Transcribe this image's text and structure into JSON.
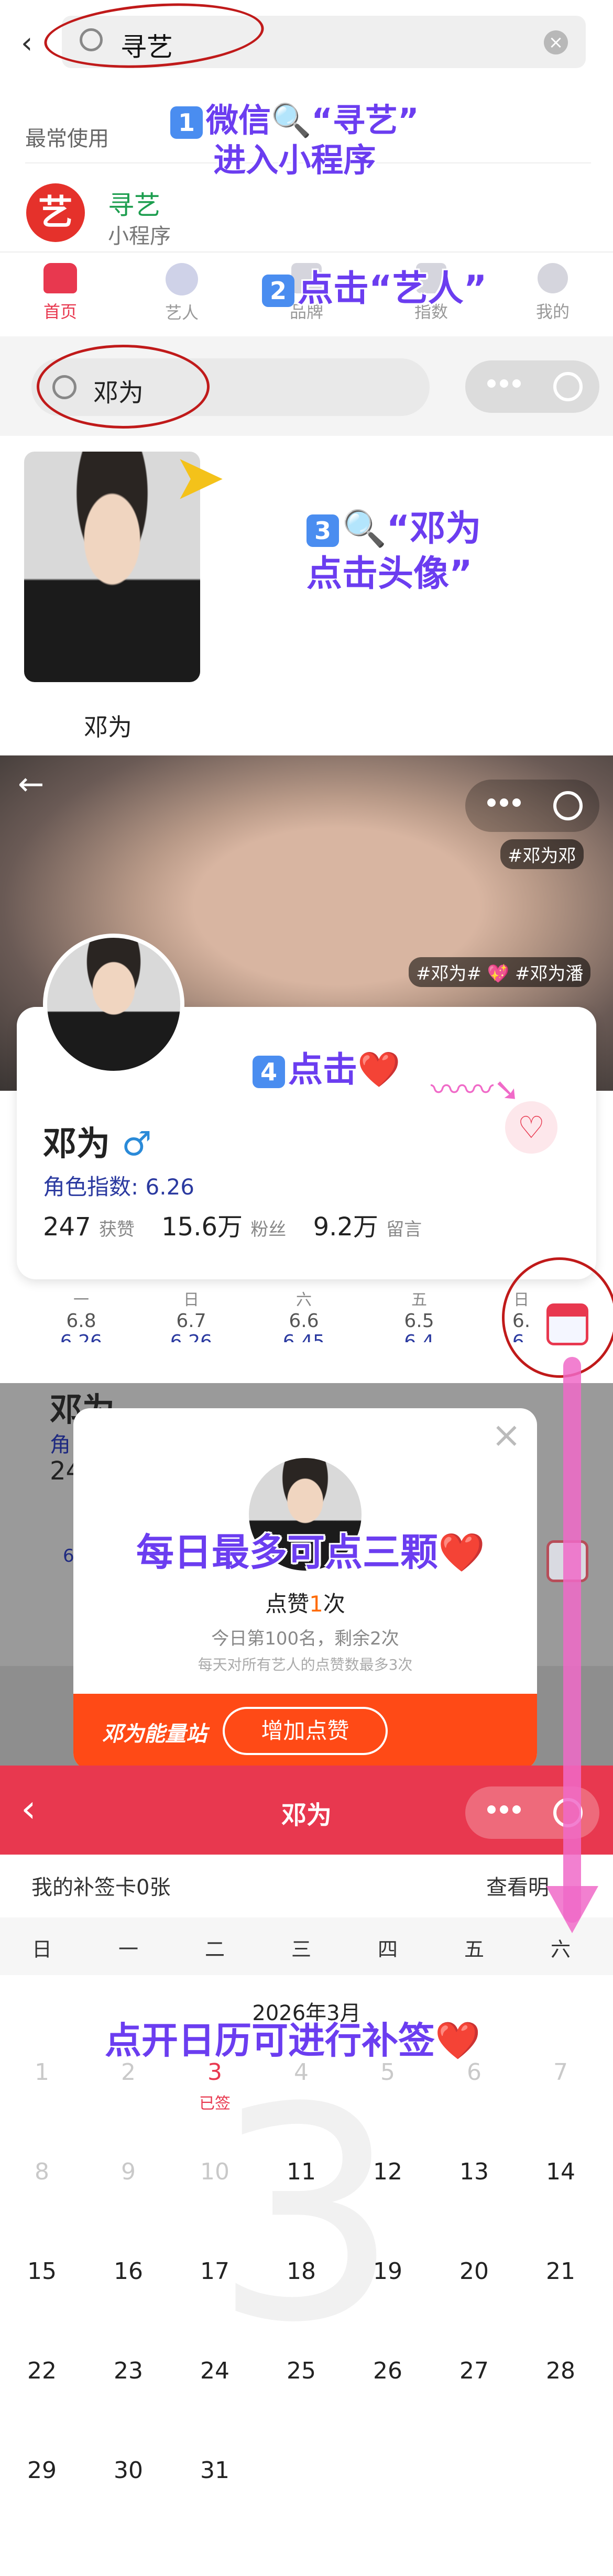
{
  "search": {
    "value": "寻艺",
    "recent_label": "最常使用",
    "app_name": "寻艺",
    "app_type": "小程序",
    "app_icon_char": "艺"
  },
  "steps": {
    "step1_a": "微信🔍“寻艺”",
    "step1_b": "进入小程序",
    "step1_num": "1",
    "step2": "点击“艺人”",
    "step2_num": "2",
    "step3_a": "🔍“邓为",
    "step3_b": "点击头像”",
    "step3_num": "3",
    "step4": "点击❤️",
    "step4_num": "4",
    "step5": "每日最多可点三颗❤️",
    "step6": "点开日历可进行补签❤️"
  },
  "tabs": [
    {
      "label": "首页",
      "active": true
    },
    {
      "label": "艺人"
    },
    {
      "label": "品牌"
    },
    {
      "label": "指数"
    },
    {
      "label": "我的"
    }
  ],
  "artist_search": {
    "value": "邓为",
    "result_name": "邓为"
  },
  "profile": {
    "tag1": "#邓为邓",
    "tag2": "#邓为#",
    "tag3": "#邓为潘",
    "name": "邓为",
    "gender": "♂",
    "index_label": "角色指数:",
    "index_value": "6.26",
    "stats": [
      {
        "value": "247",
        "label": "获赞"
      },
      {
        "value": "15.6万",
        "label": "粉丝"
      },
      {
        "value": "9.2万",
        "label": "留言"
      }
    ],
    "days": [
      {
        "wd": "一",
        "date": "6.8",
        "val": "6.26"
      },
      {
        "wd": "日",
        "date": "6.7",
        "val": "6.26"
      },
      {
        "wd": "六",
        "date": "6.6",
        "val": "6.45"
      },
      {
        "wd": "五",
        "date": "6.5",
        "val": "6.4"
      },
      {
        "wd": "日",
        "date": "6.",
        "val": "6."
      }
    ]
  },
  "modal": {
    "title_prefix": "点赞",
    "count": "1",
    "title_suffix": "次",
    "line1": "今日第100名，剩余2次",
    "line2": "每天对所有艺人的点赞数最多3次",
    "brand": "邓为能量站",
    "button": "增加点赞",
    "bg_name": "邓为",
    "bg_index": "角",
    "bg_stat": "24",
    "bg_day": "6"
  },
  "calendar": {
    "header_title": "邓为",
    "card_label": "我的补签卡0张",
    "detail_link": "查看明",
    "weekdays": [
      "日",
      "一",
      "二",
      "三",
      "四",
      "五",
      "六"
    ],
    "month": "2026年3月",
    "watermark": "3",
    "signed": "已签",
    "rows": [
      [
        "1",
        "2",
        "3",
        "4",
        "5",
        "6",
        "7"
      ],
      [
        "8",
        "9",
        "10",
        "11",
        "12",
        "13",
        "14"
      ],
      [
        "15",
        "16",
        "17",
        "18",
        "19",
        "20",
        "21"
      ],
      [
        "22",
        "23",
        "24",
        "25",
        "26",
        "27",
        "28"
      ],
      [
        "29",
        "30",
        "31"
      ]
    ]
  },
  "colors": {
    "accent": "#e8384f",
    "annotation": "#6b3df0",
    "brand_red": "#e63022",
    "orange_bar": "#ff4a16"
  }
}
